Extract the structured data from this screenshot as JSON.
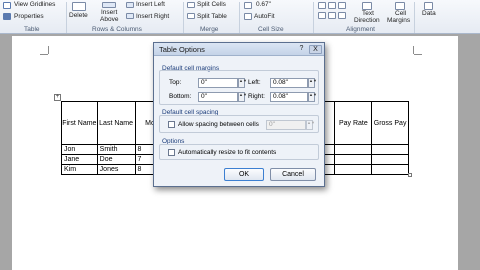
{
  "ribbon": {
    "view_gridlines": "View Gridlines",
    "properties": "Properties",
    "table_group": "Table",
    "delete": "Delete",
    "insert_above_1": "Insert",
    "insert_above_2": "Above",
    "insert_left": "Insert Left",
    "insert_right": "Insert Right",
    "rows_cols_group": "Rows & Columns",
    "split_cells": "Split Cells",
    "split_table": "Split Table",
    "merge_group": "Merge",
    "height_value": "0.67\"",
    "autofit": "AutoFit",
    "cell_size_group": "Cell Size",
    "text_direction_1": "Text",
    "text_direction_2": "Direction",
    "cell_margins_1": "Cell",
    "cell_margins_2": "Margins",
    "alignment_group": "Alignment",
    "data": "Data"
  },
  "table": {
    "headers": [
      "First Name",
      "Last Name",
      "Mond",
      "",
      "",
      "Pay Rate",
      "Gross Pay"
    ],
    "rows": [
      [
        "Jon",
        "Smith",
        "8",
        "",
        "",
        "",
        ""
      ],
      [
        "Jane",
        "Doe",
        "7",
        "",
        "",
        "",
        ""
      ],
      [
        "Kim",
        "Jones",
        "8",
        "",
        "",
        "",
        ""
      ]
    ]
  },
  "dialog": {
    "title": "Table Options",
    "help": "?",
    "close": "X",
    "section_margins": "Default cell margins",
    "top_label": "Top:",
    "top_value": "0\"",
    "left_label": "Left:",
    "left_value": "0.08\"",
    "bottom_label": "Bottom:",
    "bottom_value": "0\"",
    "right_label": "Right:",
    "right_value": "0.08\"",
    "section_spacing": "Default cell spacing",
    "allow_spacing": "Allow spacing between cells",
    "spacing_value": "0\"",
    "section_options": "Options",
    "auto_resize": "Automatically resize to fit contents",
    "ok": "OK",
    "cancel": "Cancel"
  }
}
